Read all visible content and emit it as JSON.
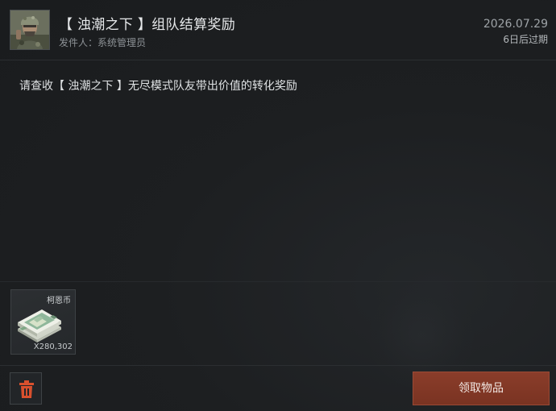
{
  "mail": {
    "title": "【 浊潮之下 】组队结算奖励",
    "sender": "发件人：系统管理员",
    "date": "2026.07.29",
    "expire": "6日后过期",
    "body": "请查收【 浊潮之下 】无尽模式队友带出价值的转化奖励"
  },
  "attachment": {
    "name": "柯恩币",
    "quantity": "X280,302",
    "icon": "banknote-stack-icon"
  },
  "actions": {
    "delete_icon": "trash-icon",
    "claim_label": "领取物品"
  },
  "colors": {
    "background": "#1c1e20",
    "claim_button": "#7e3625",
    "delete_icon": "#d8502e"
  }
}
